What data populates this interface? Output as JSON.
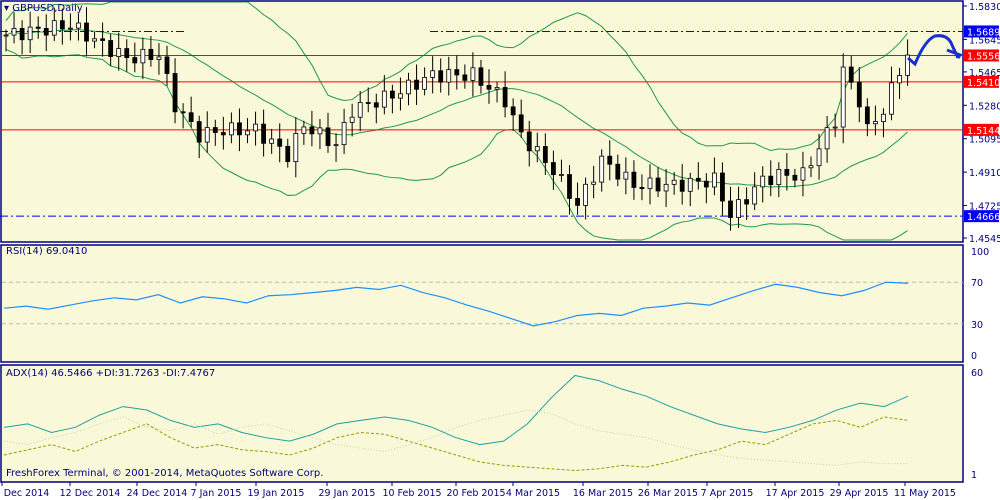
{
  "symbol_label": "GBPUSD,Daily",
  "rsi_label": "RSI(14) 69.0410",
  "adx_label": "ADX(14) 46.5466 +DI:31.7263 -DI:7.4767",
  "copyright": "FreshForex Terminal, © 2001-2014, MetaQuotes Software Corp.",
  "colors": {
    "bg": "#f9f8d8",
    "frame": "#000080",
    "bull": "#000000",
    "bands": "#1e9b4a",
    "support": "#ff0000",
    "resist": "#0000ff",
    "rsi": "#1e90ff",
    "adx": "#20a0a0",
    "pdi": "#9a9a00",
    "mdi": "#c0d8a0"
  },
  "price_axis": [
    "1.5830",
    "1.5645",
    "1.5465",
    "1.5280",
    "1.5095",
    "1.4910",
    "1.4725",
    "1.4545"
  ],
  "levels": [
    {
      "price": 1.5689,
      "label": "1.5689",
      "color": "#0000ff",
      "style": "dashdot"
    },
    {
      "price": 1.5556,
      "label": "1.5556",
      "color": "#ff0000",
      "style": "solid"
    },
    {
      "price": 1.541,
      "label": "1.5410",
      "color": "#ff0000",
      "style": "solid"
    },
    {
      "price": 1.5144,
      "label": "1.5144",
      "color": "#ff0000",
      "style": "solid"
    },
    {
      "price": 1.4666,
      "label": "1.4666",
      "color": "#0000ff",
      "style": "dashdot"
    }
  ],
  "rsi_axis": [
    "100",
    "70",
    "30",
    "0"
  ],
  "adx_axis": [
    "60",
    "1"
  ],
  "date_axis": [
    "5 Dec 2014",
    "12 Dec 2014",
    "24 Dec 2014",
    "7 Jan 2015",
    "19 Jan 2015",
    "29 Jan 2015",
    "10 Feb 2015",
    "20 Feb 2015",
    "4 Mar 2015",
    "16 Mar 2015",
    "26 Mar 2015",
    "7 Apr 2015",
    "17 Apr 2015",
    "29 Apr 2015",
    "11 May 2015"
  ],
  "chart_data": {
    "type": "candlestick",
    "price_range": [
      1.4545,
      1.583
    ],
    "close_waypoints": [
      [
        0,
        1.5669
      ],
      [
        4,
        1.5697
      ],
      [
        8,
        1.5725
      ],
      [
        12,
        1.5614
      ],
      [
        15,
        1.5542
      ],
      [
        19,
        1.5559
      ],
      [
        21,
        1.5281
      ],
      [
        24,
        1.5115
      ],
      [
        27,
        1.5143
      ],
      [
        31,
        1.5143
      ],
      [
        35,
        1.5005
      ],
      [
        37,
        1.5171
      ],
      [
        41,
        1.506
      ],
      [
        43,
        1.5254
      ],
      [
        48,
        1.5337
      ],
      [
        53,
        1.5448
      ],
      [
        58,
        1.5448
      ],
      [
        62,
        1.5309
      ],
      [
        64,
        1.5115
      ],
      [
        68,
        1.4921
      ],
      [
        71,
        1.4728
      ],
      [
        74,
        1.4977
      ],
      [
        78,
        1.4838
      ],
      [
        83,
        1.4838
      ],
      [
        88,
        1.4866
      ],
      [
        90,
        1.4672
      ],
      [
        94,
        1.4866
      ],
      [
        96,
        1.4894
      ],
      [
        99,
        1.4894
      ],
      [
        103,
        1.5198
      ],
      [
        104,
        1.5475
      ],
      [
        106,
        1.5309
      ],
      [
        107,
        1.5143
      ],
      [
        109,
        1.5254
      ],
      [
        111,
        1.5475
      ],
      [
        112,
        1.5559
      ]
    ],
    "rsi": [
      45,
      47,
      44,
      48,
      52,
      55,
      53,
      58,
      50,
      56,
      54,
      50,
      57,
      58,
      60,
      62,
      65,
      63,
      67,
      60,
      55,
      48,
      42,
      35,
      28,
      32,
      38,
      40,
      38,
      45,
      47,
      50,
      48,
      55,
      62,
      68,
      65,
      60,
      57,
      62,
      70,
      69
    ],
    "adx": [
      28,
      30,
      25,
      28,
      35,
      40,
      38,
      32,
      28,
      30,
      25,
      22,
      20,
      24,
      30,
      32,
      34,
      32,
      28,
      22,
      18,
      20,
      30,
      45,
      58,
      55,
      50,
      46,
      40,
      35,
      30,
      27,
      25,
      28,
      32,
      38,
      42,
      40,
      46
    ],
    "plus_di": [
      12,
      15,
      18,
      14,
      20,
      25,
      30,
      22,
      16,
      18,
      15,
      14,
      12,
      16,
      22,
      25,
      24,
      20,
      16,
      12,
      8,
      6,
      5,
      4,
      3,
      4,
      6,
      5,
      8,
      12,
      15,
      20,
      18,
      24,
      30,
      32,
      28,
      34,
      32
    ],
    "minus_di": [
      20,
      18,
      22,
      25,
      30,
      34,
      28,
      26,
      30,
      24,
      28,
      30,
      26,
      22,
      18,
      16,
      14,
      18,
      22,
      28,
      32,
      35,
      38,
      36,
      30,
      26,
      24,
      22,
      18,
      15,
      12,
      10,
      9,
      8,
      7,
      6,
      8,
      7,
      7
    ]
  }
}
